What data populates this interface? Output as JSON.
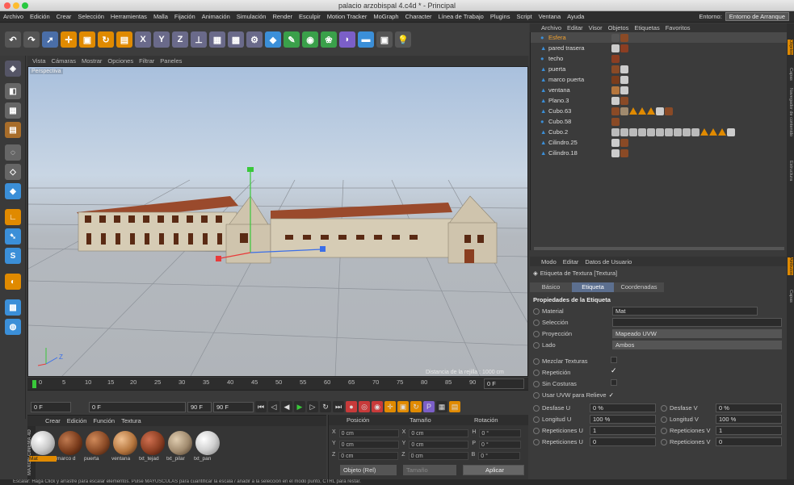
{
  "window": {
    "title": "palacio arzobispal 4.c4d * - Principal"
  },
  "menu": {
    "items": [
      "Archivo",
      "Edición",
      "Crear",
      "Selección",
      "Herramientas",
      "Malla",
      "Fijación",
      "Animación",
      "Simulación",
      "Render",
      "Esculpir",
      "Motion Tracker",
      "MoGraph",
      "Character",
      "Línea de Trabajo",
      "Plugins",
      "Script",
      "Ventana",
      "Ayuda"
    ],
    "entorno_label": "Entorno:",
    "entorno_value": "Entorno de Arranque"
  },
  "viewport": {
    "menu": [
      "Vista",
      "Cámaras",
      "Mostrar",
      "Opciones",
      "Filtrar",
      "Paneles"
    ],
    "camera_label": "Perspectiva",
    "grid_label": "Distancia de la rejilla : 1000 cm",
    "axis_z": "Z"
  },
  "timeline": {
    "ticks": [
      "0",
      "5",
      "10",
      "15",
      "20",
      "25",
      "30",
      "35",
      "40",
      "45",
      "50",
      "55",
      "60",
      "65",
      "70",
      "75",
      "80",
      "85",
      "90"
    ],
    "end_field": "0 F"
  },
  "transport": {
    "start": "0 F",
    "preview_start": "0 F",
    "preview_end": "90 F",
    "end": "90 F"
  },
  "materials": {
    "menu": [
      "Crear",
      "Edición",
      "Función",
      "Textura"
    ],
    "items": [
      {
        "label": "Mat",
        "color": "#c9c9c9"
      },
      {
        "label": "marco d",
        "color": "#7a3c1c"
      },
      {
        "label": "puerta",
        "color": "#8a4a26"
      },
      {
        "label": "ventana",
        "color": "#b5763e"
      },
      {
        "label": "txt_tejad",
        "color": "#8b3e22"
      },
      {
        "label": "txt_pilar",
        "color": "#a08a6e"
      },
      {
        "label": "txt_pan",
        "color": "#d0d0d0"
      }
    ],
    "brand": "MAXON CINEMA 4D"
  },
  "coords": {
    "headers": [
      "Posición",
      "Tamaño",
      "Rotación"
    ],
    "rows": [
      {
        "axis": "X",
        "pos": "0 cm",
        "size_axis": "X",
        "size": "0 cm",
        "rot_axis": "H",
        "rot": "0 °"
      },
      {
        "axis": "Y",
        "pos": "0 cm",
        "size_axis": "Y",
        "size": "0 cm",
        "rot_axis": "P",
        "rot": "0 °"
      },
      {
        "axis": "Z",
        "pos": "0 cm",
        "size_axis": "Z",
        "size": "0 cm",
        "rot_axis": "B",
        "rot": "0 °"
      }
    ],
    "mode": "Objeto (Rel)",
    "size_mode": "Tamaño",
    "apply": "Aplicar"
  },
  "objects": {
    "menu": [
      "Archivo",
      "Editar",
      "Visor",
      "Objetos",
      "Etiquetas",
      "Favoritos"
    ],
    "items": [
      "Esfera",
      "pared trasera",
      "techo",
      "puerta",
      "marco puerta",
      "ventana",
      "Plano.3",
      "Cubo.63",
      "Cubo.58",
      "Cubo.2",
      "Cilindro.25",
      "Cilindro.18"
    ]
  },
  "attributes": {
    "menu": [
      "Modo",
      "Editar",
      "Datos de Usuario"
    ],
    "title": "Etiqueta de Textura [Textura]",
    "tabs": [
      "Básico",
      "Etiqueta",
      "Coordenadas"
    ],
    "section": "Propiedades de la Etiqueta",
    "material_label": "Material",
    "material_value": "Mat",
    "seleccion_label": "Selección",
    "proyeccion_label": "Proyección",
    "proyeccion_value": "Mapeado UVW",
    "lado_label": "Lado",
    "lado_value": "Ambos",
    "mezclar": "Mezclar Texturas",
    "repeticion": "Repetición",
    "sin_costuras": "Sin Costuras",
    "usar_uvw": "Usar UVW para Relieve",
    "desfase_u_label": "Desfase U",
    "desfase_u": "0 %",
    "desfase_v_label": "Desfase V",
    "desfase_v": "0 %",
    "longitud_u_label": "Longitud U",
    "longitud_u": "100 %",
    "longitud_v_label": "Longitud V",
    "longitud_v": "100 %",
    "rep_u_label": "Repeticiones U",
    "rep_u": "1",
    "rep_v_label": "Repeticiones V",
    "rep_v": "1",
    "rep_u2_label": "Repeticiones U",
    "rep_u2": "0",
    "rep_v2_label": "Repeticiones V",
    "rep_v2": "0"
  },
  "side_tabs": [
    "Objetos",
    "Capas",
    "Navegador de contenido",
    "Estructura",
    "Atributos",
    "Capas"
  ],
  "status": "Escalar: Haga Click y arrastre para escalar elementos. Pulse MAYUSCULAS para cuantificar la escala / añadir a la selección en el modo punto, CTRL para restar."
}
